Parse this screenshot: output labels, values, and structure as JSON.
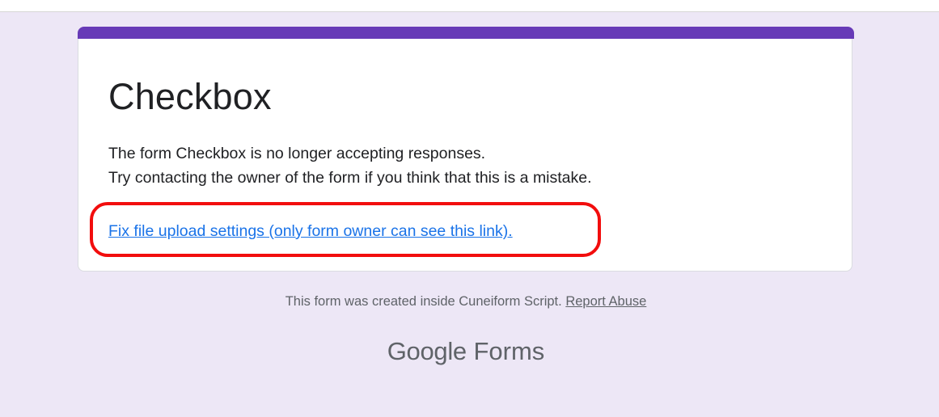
{
  "form": {
    "title": "Checkbox",
    "message_line1": "The form Checkbox is no longer accepting responses.",
    "message_line2": "Try contacting the owner of the form if you think that this is a mistake.",
    "owner_link": "Fix file upload settings (only form owner can see this link)."
  },
  "footer": {
    "note": "This form was created inside Cuneiform Script.",
    "report_link": "Report Abuse"
  },
  "brand": {
    "google": "Google",
    "forms": "Forms"
  },
  "colors": {
    "accent": "#673ab7",
    "page_background": "#ede7f6",
    "link": "#1a73e8",
    "highlight": "#f20d0d"
  }
}
